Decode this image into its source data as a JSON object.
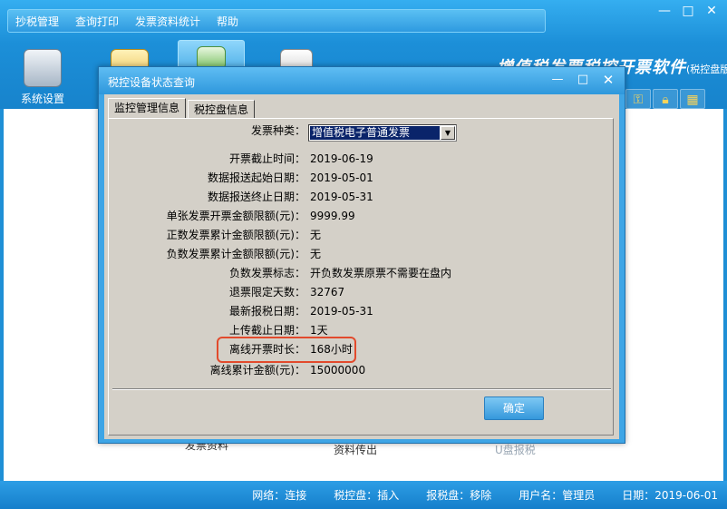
{
  "app": {
    "title": "增值税发票税控开票软件",
    "edition": "(税控盘版)",
    "menu": [
      "抄税管理",
      "查询打印",
      "发票资料统计",
      "帮助"
    ],
    "window_controls": [
      "—",
      "□",
      "✕"
    ],
    "toolbar": {
      "system_settings": "系统设置"
    },
    "background_labels": {
      "invoice_data": "发票资料",
      "data_upload": "资料传出",
      "u_disk": "U盘报税"
    }
  },
  "status_bar": {
    "network": "网络：连接",
    "tax_disk": "税控盘：插入",
    "report_disk": "报税盘：移除",
    "user": "用户名：管理员",
    "date": "日期：2019-06-01"
  },
  "dialog": {
    "title": "税控设备状态查询",
    "controls": [
      "—",
      "□",
      "✕"
    ],
    "tabs": [
      "监控管理信息",
      "税控盘信息"
    ],
    "invoice_type_label": "发票种类：",
    "invoice_type_value": "增值税电子普通发票",
    "fields": [
      {
        "label": "开票截止时间：",
        "value": "2019-06-19"
      },
      {
        "label": "数据报送起始日期：",
        "value": "2019-05-01"
      },
      {
        "label": "数据报送终止日期：",
        "value": "2019-05-31"
      },
      {
        "label": "单张发票开票金额限额(元)：",
        "value": "9999.99"
      },
      {
        "label": "正数发票累计金额限额(元)：",
        "value": "无"
      },
      {
        "label": "负数发票累计金额限额(元)：",
        "value": "无"
      },
      {
        "label": "负数发票标志：",
        "value": "开负数发票原票不需要在盘内"
      },
      {
        "label": "退票限定天数：",
        "value": "32767"
      },
      {
        "label": "最新报税日期：",
        "value": "2019-05-31"
      },
      {
        "label": "上传截止日期：",
        "value": "1天"
      },
      {
        "label": "离线开票时长：",
        "value": "168小时"
      },
      {
        "label": "离线累计金额(元)：",
        "value": "15000000"
      }
    ],
    "ok_button": "确定"
  },
  "colors": {
    "accent": "#2e97dc",
    "highlight": "#e24a2c",
    "selection": "#0a246a"
  }
}
